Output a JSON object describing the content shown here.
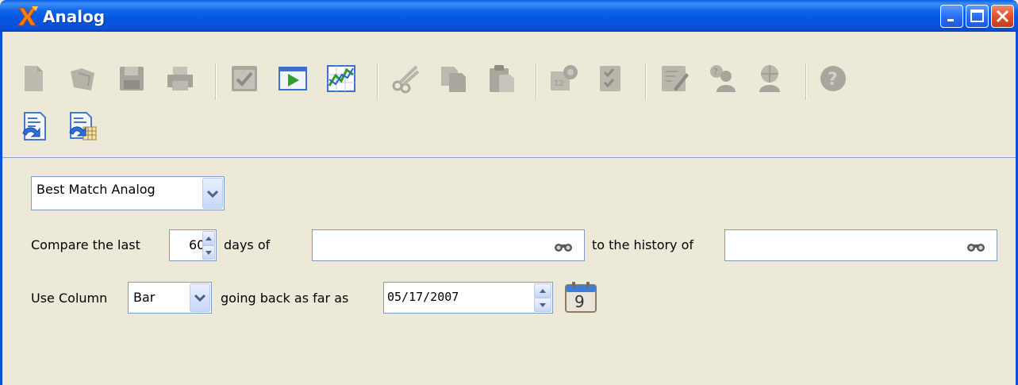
{
  "window": {
    "title": "Analog",
    "controls": [
      "minimize-icon",
      "maximize-icon",
      "close-icon"
    ]
  },
  "toolbar": {
    "row1_icons": [
      "new-document-icon",
      "open-icon",
      "save-icon",
      "print-icon",
      "checklist-icon",
      "run-icon",
      "chart-icon",
      "cut-icon",
      "copy-icon",
      "paste-icon",
      "calendar-settings-icon",
      "checkbox-icon",
      "edit-icon",
      "users-help-icon",
      "user-globe-icon",
      "help-icon"
    ],
    "row2_icons": [
      "refresh-document-icon",
      "refresh-table-icon"
    ]
  },
  "form": {
    "method_select": "Best Match Analog",
    "compare_prefix": "Compare the last",
    "days_value": "60",
    "days_of_label": "days of",
    "source_value": "",
    "history_label": "to the history of",
    "history_value": "",
    "use_column_label": "Use Column",
    "column_select": "Bar",
    "going_back_label": "going back as far as",
    "date_value": "05/17/2007",
    "calendar_day": "9"
  },
  "colors": {
    "title_bar": "#0a52d8",
    "background": "#ece9d8",
    "field_border": "#7f9db9",
    "close_button": "#e2512e"
  }
}
